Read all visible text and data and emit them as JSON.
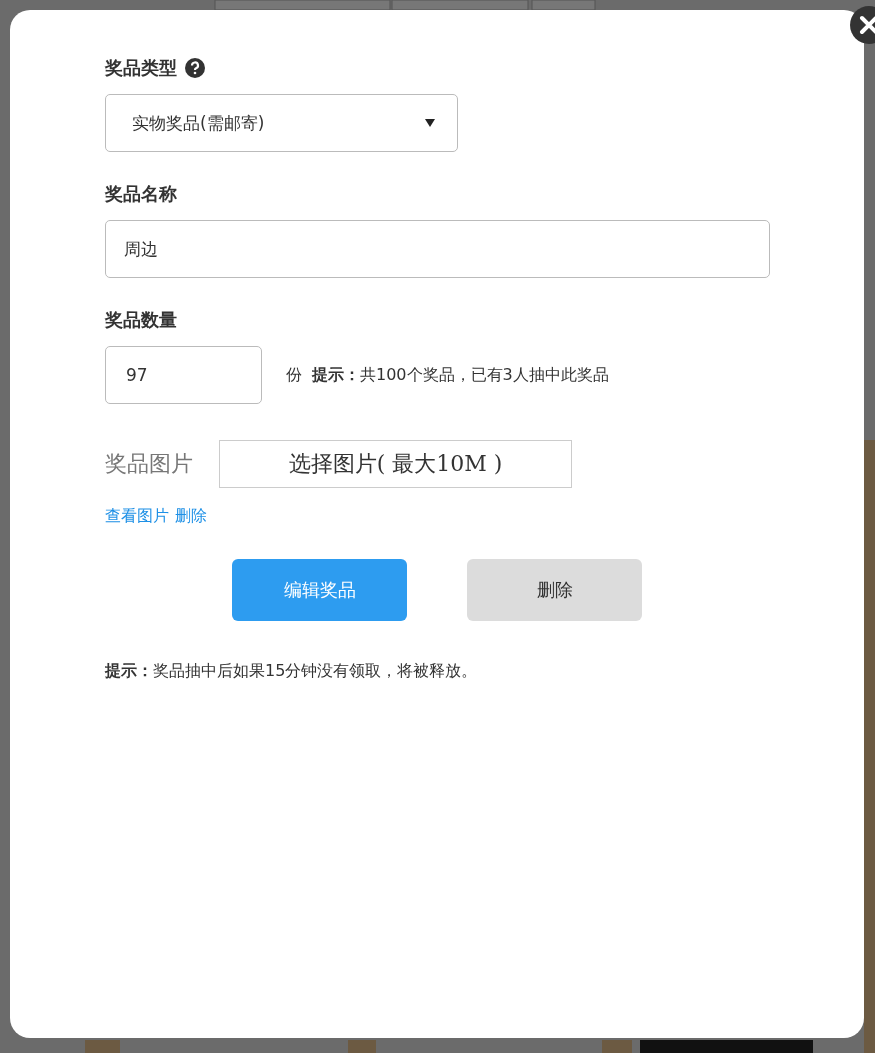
{
  "dialog": {
    "fields": [
      {
        "kind": "select",
        "label": "奖品类型",
        "help": true,
        "value": "实物奖品(需邮寄)"
      },
      {
        "kind": "text",
        "label": "奖品名称",
        "value": "周边"
      },
      {
        "kind": "quantity",
        "label": "奖品数量",
        "value": "97",
        "unit": "份",
        "hint": "**提示：**共100个奖品，已有3人抽中此奖品"
      },
      {
        "kind": "image",
        "label": "奖品图片",
        "button": "选择图片( 最大10M )",
        "links": [
          "查看图片",
          "删除"
        ]
      }
    ],
    "buttons": [
      {
        "label": "编辑奖品",
        "kind": "primary"
      },
      {
        "label": "删除",
        "kind": "secondary"
      }
    ],
    "note": "**提示：**奖品抽中后如果15分钟没有领取，将被释放。"
  }
}
